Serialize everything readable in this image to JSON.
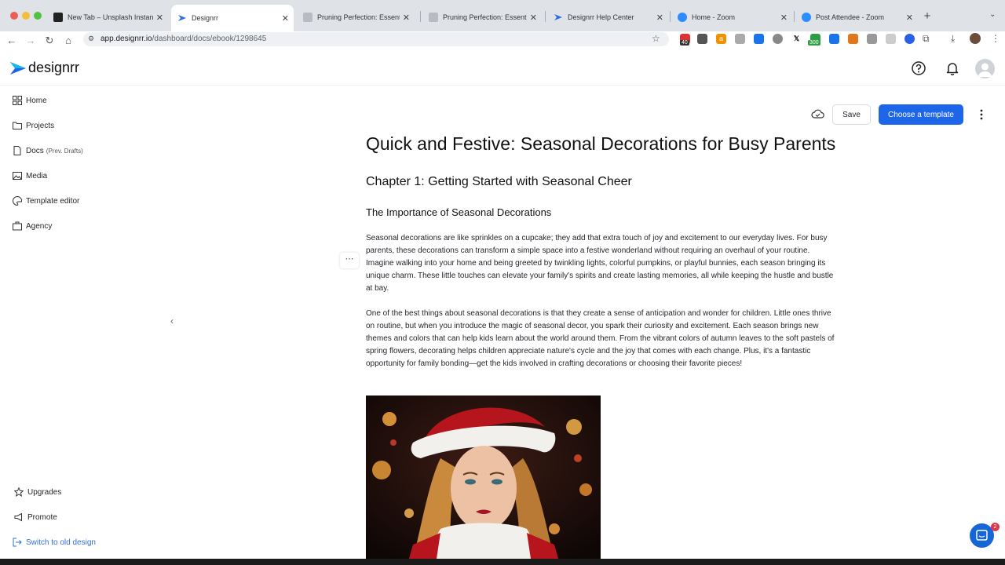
{
  "browser": {
    "tabs": [
      {
        "title": "New Tab – Unsplash Instant",
        "favicon_color": "#222222",
        "active": false
      },
      {
        "title": "Designrr",
        "favicon_color": "#2b6de0",
        "active": true
      },
      {
        "title": "Pruning Perfection: Essential",
        "favicon_color": "#b8bcc2",
        "active": false
      },
      {
        "title": "Pruning Perfection: Essential",
        "favicon_color": "#b8bcc2",
        "active": false
      },
      {
        "title": "Designrr Help Center",
        "favicon_color": "#2b6de0",
        "active": false
      },
      {
        "title": "Home - Zoom",
        "favicon_color": "#2d8cff",
        "active": false
      },
      {
        "title": "Post Attendee - Zoom",
        "favicon_color": "#2d8cff",
        "active": false
      }
    ],
    "url_host": "app.designrr.io",
    "url_path": "/dashboard/docs/ebook/1298645",
    "extension_badges": {
      "first": "40",
      "second": "300"
    }
  },
  "app": {
    "logo_text": "designrr",
    "brand_color": "#1d66ea"
  },
  "sidebar": {
    "items": [
      {
        "label": "Home",
        "icon": "grid-icon"
      },
      {
        "label": "Projects",
        "icon": "folder-icon"
      },
      {
        "label": "Docs",
        "sub": "(Prev. Drafts)",
        "icon": "file-icon"
      },
      {
        "label": "Media",
        "icon": "image-icon"
      },
      {
        "label": "Template editor",
        "icon": "palette-icon"
      },
      {
        "label": "Agency",
        "icon": "briefcase-icon"
      }
    ],
    "bottom_items": [
      {
        "label": "Upgrades",
        "icon": "star-icon"
      },
      {
        "label": "Promote",
        "icon": "megaphone-icon"
      },
      {
        "label": "Switch to old design",
        "icon": "switch-icon"
      }
    ]
  },
  "doc_toolbar": {
    "save_label": "Save",
    "template_label": "Choose a template"
  },
  "document": {
    "title": "Quick and Festive: Seasonal Decorations for Busy Parents",
    "chapter": "Chapter 1: Getting Started with Seasonal Cheer",
    "section": "The Importance of Seasonal Decorations",
    "paragraphs": [
      "Seasonal decorations are like sprinkles on a cupcake; they add that extra touch of joy and excitement to our everyday lives. For busy parents, these decorations can transform a simple space into a festive wonderland without requiring an overhaul of your routine. Imagine walking into your home and being greeted by twinkling lights, colorful pumpkins, or playful bunnies, each season bringing its unique charm. These little touches can elevate your family's spirits and create lasting memories, all while keeping the hustle and bustle at bay.",
      "One of the best things about seasonal decorations is that they create a sense of anticipation and wonder for children. Little ones thrive on routine, but when you introduce the magic of seasonal decor, you spark their curiosity and excitement. Each season brings new themes and colors that can help kids learn about the world around them. From the vibrant colors of autumn leaves to the soft pastels of spring flowers, decorating helps children appreciate nature's cycle and the joy that comes with each change. Plus, it's a fantastic opportunity for family bonding—get the kids involved in crafting decorations or choosing their favorite pieces!"
    ]
  },
  "chat": {
    "badge": "2"
  }
}
